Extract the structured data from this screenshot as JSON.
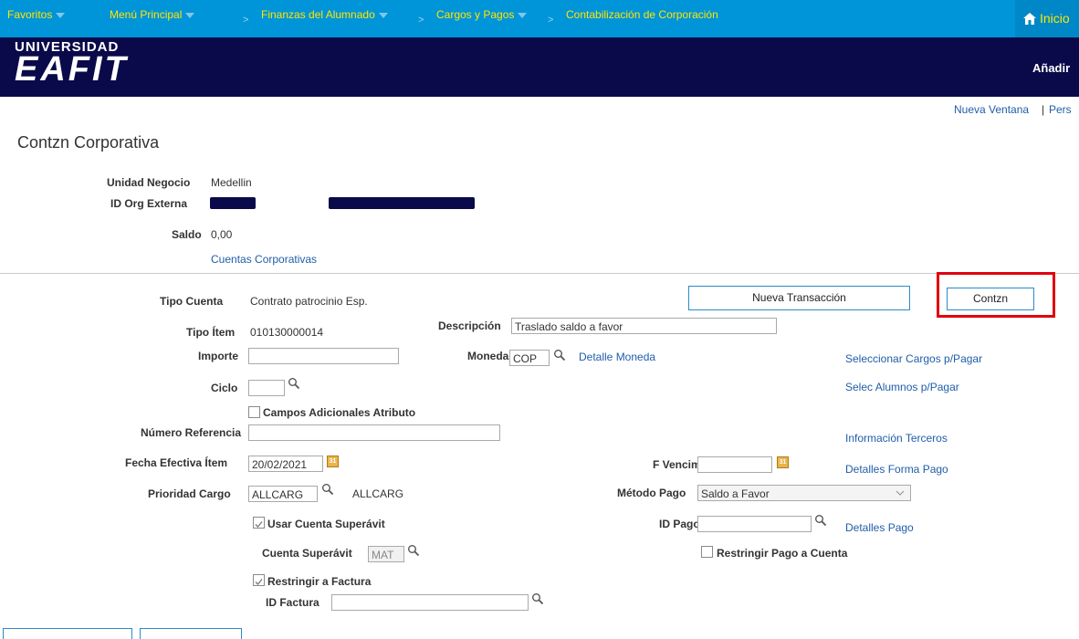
{
  "nav": {
    "favoritos": "Favoritos",
    "menu_principal": "Menú Principal",
    "finanzas": "Finanzas del Alumnado",
    "cargos": "Cargos y Pagos",
    "contabilizacion": "Contabilización de Corporación",
    "inicio": "Inicio"
  },
  "banner": {
    "logo_top": "UNIVERSIDAD",
    "logo_main": "EAFIT",
    "anadir": "Añadir"
  },
  "header_links": {
    "nueva_ventana": "Nueva Ventana",
    "separator": "|",
    "per": "Pers"
  },
  "page_title": "Contzn Corporativa",
  "summary": {
    "unidad_negocio_label": "Unidad Negocio",
    "unidad_negocio_value": "Medellin",
    "id_org_label": "ID Org Externa",
    "saldo_label": "Saldo",
    "saldo_value": "0,00",
    "cuentas_link": "Cuentas Corporativas"
  },
  "form": {
    "tipo_cuenta_label": "Tipo Cuenta",
    "tipo_cuenta_value": "Contrato patrocinio Esp.",
    "tipo_item_label": "Tipo Ítem",
    "tipo_item_value": "010130000014",
    "descripcion_label": "Descripción",
    "descripcion_value": "Traslado saldo a favor",
    "importe_label": "Importe",
    "importe_value": "",
    "moneda_label": "Moneda",
    "moneda_value": "COP",
    "detalle_moneda_link": "Detalle Moneda",
    "ciclo_label": "Ciclo",
    "ciclo_value": "",
    "campos_adicionales_label": "Campos Adicionales Atributo",
    "numero_referencia_label": "Número Referencia",
    "numero_referencia_value": "",
    "fecha_efectiva_label": "Fecha Efectiva Ítem",
    "fecha_efectiva_value": "20/02/2021",
    "f_vencim_label": "F Vencim",
    "f_vencim_value": "",
    "prioridad_cargo_label": "Prioridad Cargo",
    "prioridad_cargo_value": "ALLCARG",
    "prioridad_cargo_desc": "ALLCARG",
    "metodo_pago_label": "Método Pago",
    "metodo_pago_value": "Saldo a Favor",
    "usar_cuenta_label": "Usar Cuenta Superávit",
    "id_pago_label": "ID Pago",
    "id_pago_value": "",
    "detalles_pago_link": "Detalles Pago",
    "cuenta_superavit_label": "Cuenta Superávit",
    "cuenta_superavit_value": "MAT",
    "restringir_pago_label": "Restringir Pago a Cuenta",
    "restringir_factura_label": "Restringir a Factura",
    "id_factura_label": "ID Factura",
    "id_factura_value": ""
  },
  "buttons": {
    "nueva_transaccion": "Nueva Transacción",
    "contzn": "Contzn"
  },
  "right_links": {
    "seleccionar_cargos": "Seleccionar Cargos p/Pagar",
    "selec_alumnos": "Selec Alumnos p/Pagar",
    "informacion_terceros": "Información Terceros",
    "detalles_forma_pago": "Detalles Forma Pago"
  },
  "colors": {
    "nav_bg": "#0094d8",
    "nav_text": "#ffe700",
    "banner_bg": "#0a0a4a",
    "link": "#1f5ea8",
    "highlight": "#e0000f"
  }
}
